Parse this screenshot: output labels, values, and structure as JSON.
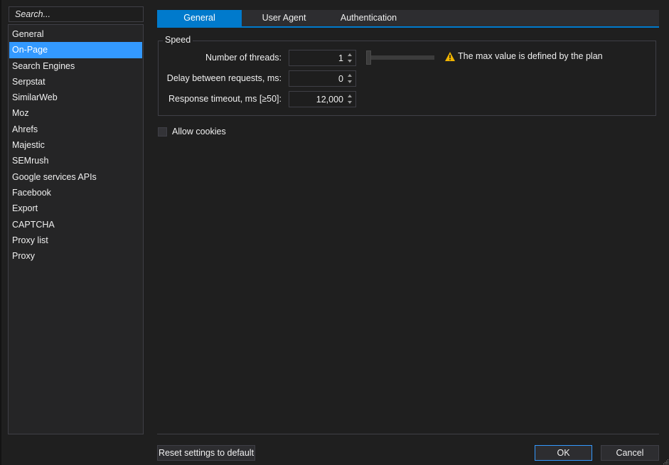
{
  "search": {
    "placeholder": "Search..."
  },
  "sidebar": {
    "items": [
      {
        "label": "General",
        "active": false
      },
      {
        "label": "On-Page",
        "active": true
      },
      {
        "label": "Search Engines",
        "active": false
      },
      {
        "label": "Serpstat",
        "active": false
      },
      {
        "label": "SimilarWeb",
        "active": false
      },
      {
        "label": "Moz",
        "active": false
      },
      {
        "label": "Ahrefs",
        "active": false
      },
      {
        "label": "Majestic",
        "active": false
      },
      {
        "label": "SEMrush",
        "active": false
      },
      {
        "label": "Google services APIs",
        "active": false
      },
      {
        "label": "Facebook",
        "active": false
      },
      {
        "label": "Export",
        "active": false
      },
      {
        "label": "CAPTCHA",
        "active": false
      },
      {
        "label": "Proxy list",
        "active": false
      },
      {
        "label": "Proxy",
        "active": false
      }
    ]
  },
  "tabs": [
    {
      "label": "General",
      "active": true
    },
    {
      "label": "User Agent",
      "active": false
    },
    {
      "label": "Authentication",
      "active": false
    }
  ],
  "speed": {
    "title": "Speed",
    "threads": {
      "label": "Number of threads:",
      "value": "1"
    },
    "delay": {
      "label": "Delay between requests, ms:",
      "value": "0"
    },
    "timeout": {
      "label": "Response timeout, ms [≥50]:",
      "value": "12,000"
    },
    "slider": {
      "value_fraction": 0
    },
    "warning": "The max value is defined by the plan"
  },
  "cookies": {
    "label": "Allow cookies",
    "checked": false
  },
  "footer": {
    "reset_label": "Reset settings to default",
    "ok_label": "OK",
    "cancel_label": "Cancel"
  },
  "colors": {
    "accent": "#007acc",
    "selection": "#3399ff",
    "warning": "#f0b400",
    "background": "#1f1f1f"
  }
}
